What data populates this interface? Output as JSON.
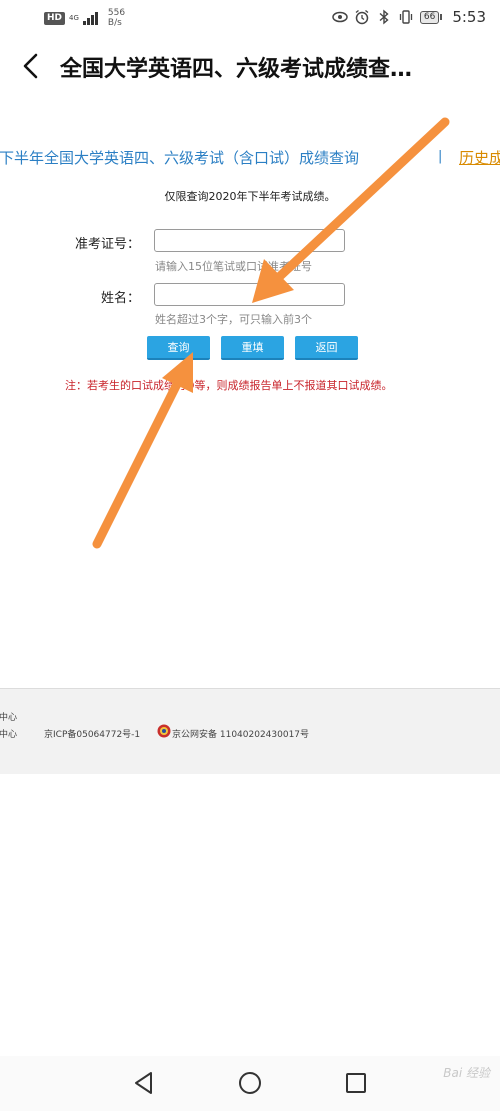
{
  "status_bar": {
    "hd": "HD",
    "net_type": "4G",
    "speed_value": "556",
    "speed_unit": "B/s",
    "battery": "66",
    "time": "5:53"
  },
  "app_bar": {
    "title": "全国大学英语四、六级考试成绩查…"
  },
  "page": {
    "heading": "年下半年全国大学英语四、六级考试（含口试）成绩查询",
    "separator": "|",
    "history_link": "历史成",
    "notice": "仅限查询2020年下半年考试成绩。"
  },
  "form": {
    "exam_id_label": "准考证号：",
    "exam_id_value": "",
    "exam_id_hint": "请输入15位笔试或口试准考证号",
    "name_label": "姓名：",
    "name_value": "",
    "name_hint": "姓名超过3个字，可只输入前3个",
    "query_button": "查询",
    "reset_button": "重填",
    "return_button": "返回",
    "note": "注：若考生的口试成绩为D等，则成绩报告单上不报道其口试成绩。"
  },
  "footer": {
    "line1": "试中心",
    "line2": "试中心",
    "icp": "京ICP备05064772号-1",
    "police": "京公网安备 11040202430017号"
  },
  "nav": {
    "back_icon": "triangle-back-icon",
    "home_icon": "circle-home-icon",
    "recent_icon": "square-recent-icon",
    "watermark": "Bai 经验"
  },
  "colors": {
    "heading": "#2b7fc4",
    "link": "#d88a00",
    "button": "#2ba4e2",
    "note": "#c8242b",
    "arrow": "#f5913e"
  }
}
